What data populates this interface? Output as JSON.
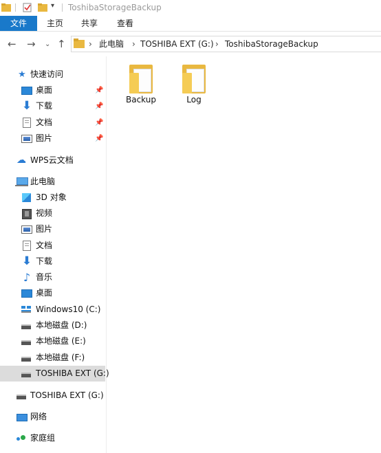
{
  "window": {
    "title": "ToshibaStorageBackup"
  },
  "ribbon": {
    "tabs": [
      "文件",
      "主页",
      "共享",
      "查看"
    ]
  },
  "address": {
    "crumbs": [
      "此电脑",
      "TOSHIBA EXT (G:)",
      "ToshibaStorageBackup"
    ]
  },
  "sidebar": {
    "quick_access": "快速访问",
    "quick_items": [
      "桌面",
      "下载",
      "文档",
      "图片"
    ],
    "wps": "WPS云文档",
    "this_pc": "此电脑",
    "pc_items": [
      "3D 对象",
      "视频",
      "图片",
      "文档",
      "下载",
      "音乐",
      "桌面",
      "Windows10 (C:)",
      "本地磁盘 (D:)",
      "本地磁盘 (E:)",
      "本地磁盘 (F:)",
      "TOSHIBA EXT (G:)"
    ],
    "external_drive": "TOSHIBA EXT (G:)",
    "network": "网络",
    "homegroup": "家庭组"
  },
  "content": {
    "folders": [
      "Backup",
      "Log"
    ]
  }
}
